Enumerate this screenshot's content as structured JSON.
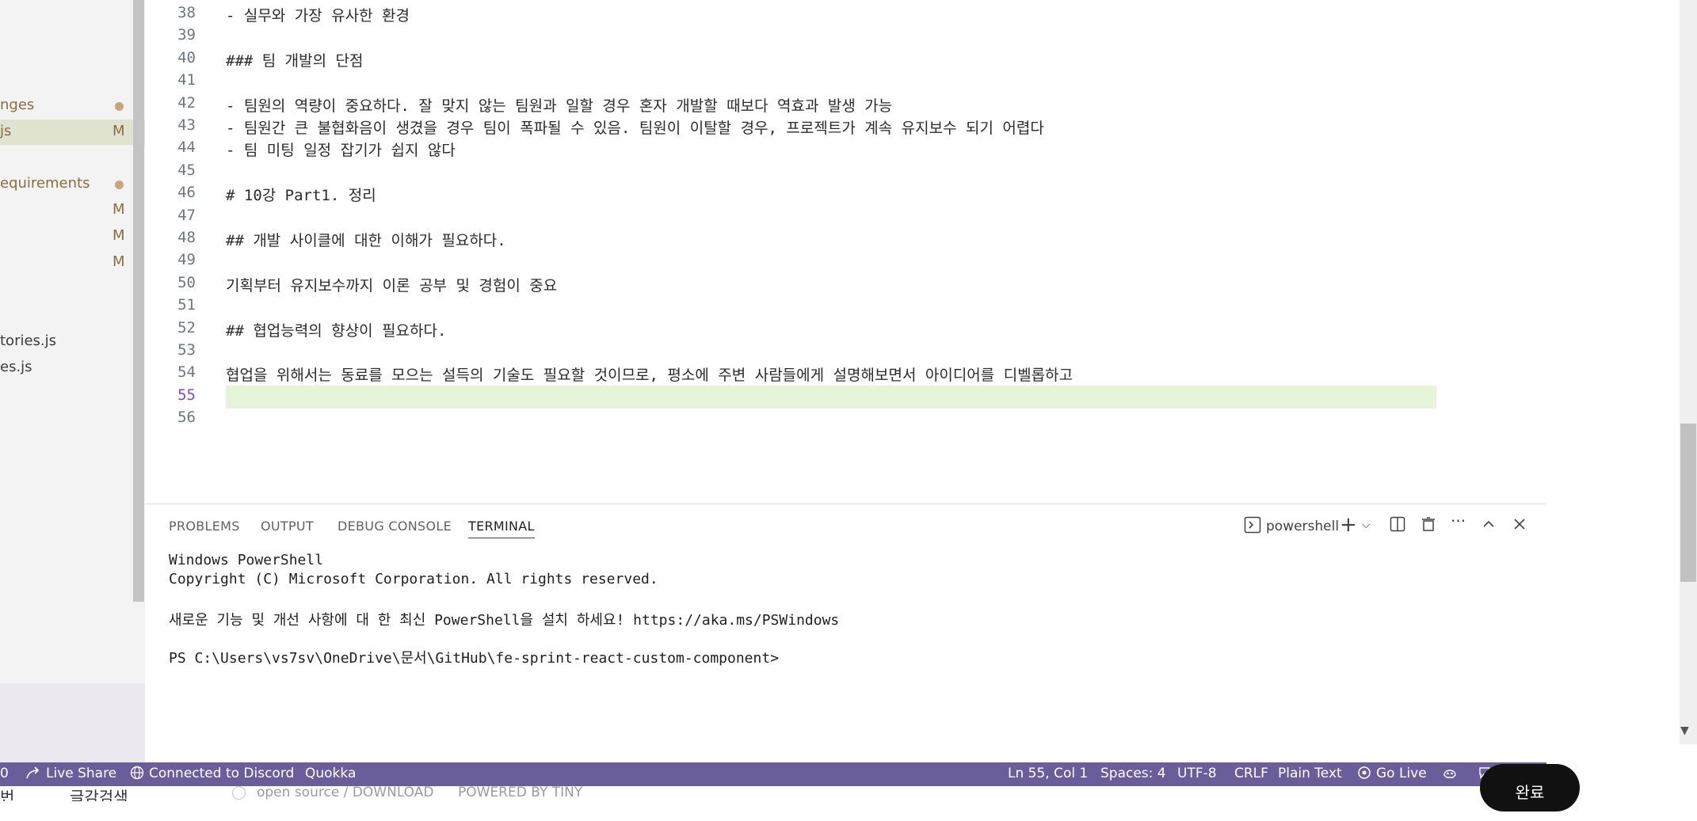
{
  "sidebar": {
    "items": [
      {
        "label": "nges",
        "color": "#8c6c3e",
        "dot": true,
        "badge": ""
      },
      {
        "label": "js",
        "color": "#8c6c3e",
        "dot": false,
        "badge": "M",
        "selected": true
      },
      {
        "label": "equirements",
        "color": "#8c6c3e",
        "dot": true,
        "badge": ""
      },
      {
        "label": "",
        "color": "#8c6c3e",
        "dot": false,
        "badge": "M"
      },
      {
        "label": "",
        "color": "#8c6c3e",
        "dot": false,
        "badge": "M"
      },
      {
        "label": "",
        "color": "#8c6c3e",
        "dot": false,
        "badge": "M"
      },
      {
        "label": "tories.js",
        "color": "#3b3b3b",
        "dot": false,
        "badge": ""
      },
      {
        "label": "es.js",
        "color": "#3b3b3b",
        "dot": false,
        "badge": ""
      }
    ]
  },
  "editor": {
    "active_line": 55,
    "lines": [
      {
        "n": "38",
        "text": "- 실무와 가장 유사한 환경"
      },
      {
        "n": "39",
        "text": ""
      },
      {
        "n": "40",
        "text": "### 팀 개발의 단점"
      },
      {
        "n": "41",
        "text": ""
      },
      {
        "n": "42",
        "text": "- 팀원의 역량이 중요하다. 잘 맞지 않는 팀원과 일할 경우 혼자 개발할 때보다 역효과 발생 가능"
      },
      {
        "n": "43",
        "text": "- 팀원간 큰 불협화음이 생겼을 경우 팀이 폭파될 수 있음. 팀원이 이탈할 경우, 프로젝트가 계속 유지보수 되기 어렵다"
      },
      {
        "n": "44",
        "text": "- 팀 미팅 일정 잡기가 쉽지 않다"
      },
      {
        "n": "45",
        "text": ""
      },
      {
        "n": "46",
        "text": "# 10강 Part1. 정리"
      },
      {
        "n": "47",
        "text": ""
      },
      {
        "n": "48",
        "text": "## 개발 사이클에 대한 이해가 필요하다."
      },
      {
        "n": "49",
        "text": ""
      },
      {
        "n": "50",
        "text": "기획부터 유지보수까지 이론 공부 및 경험이 중요"
      },
      {
        "n": "51",
        "text": ""
      },
      {
        "n": "52",
        "text": "## 협업능력의 향상이 필요하다."
      },
      {
        "n": "53",
        "text": ""
      },
      {
        "n": "54",
        "text": "협업을 위해서는 동료를 모으는 설득의 기술도 필요할 것이므로, 평소에 주변 사람들에게 설명해보면서 아이디어를 디벨롭하고"
      },
      {
        "n": "55",
        "text": ""
      },
      {
        "n": "56",
        "text": ""
      }
    ]
  },
  "panel": {
    "tabs": [
      "PROBLEMS",
      "OUTPUT",
      "DEBUG CONSOLE",
      "TERMINAL"
    ],
    "active_tab": "TERMINAL",
    "shell_name": "powershell",
    "terminal_lines": [
      "Windows PowerShell",
      "Copyright (C) Microsoft Corporation. All rights reserved.",
      "",
      "새로운 기능 및 개선 사항에 대 한 최신 PowerShell을 설치 하세요! https://aka.ms/PSWindows",
      "",
      "PS C:\\Users\\vs7sv\\OneDrive\\문서\\GitHub\\fe-sprint-react-custom-component>"
    ]
  },
  "statusbar": {
    "left_fragment": "0",
    "live_share": "Live Share",
    "discord": "Connected to Discord",
    "quokka": "Quokka",
    "position": "Ln 55, Col 1",
    "spaces": "Spaces: 4",
    "encoding": "UTF-8",
    "eol": "CRLF",
    "language": "Plain Text",
    "go_live": "Go Live",
    "background_color": "#6a5d9a"
  },
  "bottom_strip": {
    "fragment_a": "번",
    "fragment_b": "글감검색",
    "fragment_c": "open source / DOWNLOAD",
    "fragment_d": "POWERED BY TINY",
    "done_button": "완료"
  }
}
